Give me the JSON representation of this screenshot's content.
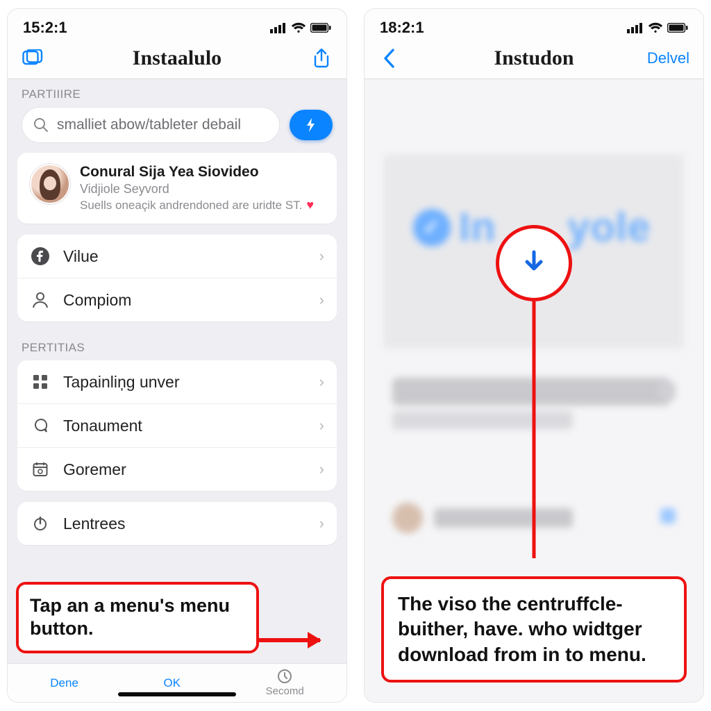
{
  "left": {
    "status_time": "15:2:1",
    "nav_title": "Instaalulo",
    "section1_label": "PARTIIIRE",
    "search_placeholder": "smalliet abow/tableter debail",
    "profile": {
      "title": "Conural Sija Yea Siovideo",
      "subtitle": "Vidjiole Seyvord",
      "desc": "Suells oneaçik andrendoned are uridte ST."
    },
    "list1": [
      {
        "icon": "facebook-icon",
        "label": "Vilue"
      },
      {
        "icon": "person-icon",
        "label": "Compiom"
      }
    ],
    "section2_label": "PERTITIAS",
    "list2": [
      {
        "icon": "grid-icon",
        "label": "Tapainliņg unver"
      },
      {
        "icon": "comment-icon",
        "label": "Tonaument"
      },
      {
        "icon": "calendar-icon",
        "label": "Goremer"
      }
    ],
    "list3": [
      {
        "icon": "power-icon",
        "label": "Lentrees"
      }
    ],
    "toolbar": {
      "left": "Dene",
      "mid": "OK",
      "right": "Secomd"
    },
    "callout": "Tap an a menu's menu button."
  },
  "right": {
    "status_time": "18:2:1",
    "nav_title": "Instudon",
    "nav_action": "Delvel",
    "logo_text": "In      yole",
    "callout": "The viso the centruffcle-buither, have. who widtger download from in to menu."
  }
}
